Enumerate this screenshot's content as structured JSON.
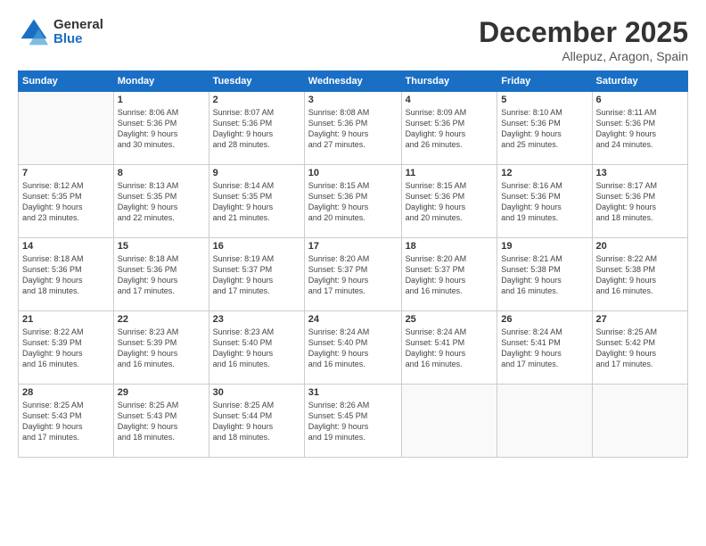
{
  "logo": {
    "line1": "General",
    "line2": "Blue"
  },
  "header": {
    "month": "December 2025",
    "location": "Allepuz, Aragon, Spain"
  },
  "weekdays": [
    "Sunday",
    "Monday",
    "Tuesday",
    "Wednesday",
    "Thursday",
    "Friday",
    "Saturday"
  ],
  "weeks": [
    [
      {
        "day": "",
        "info": ""
      },
      {
        "day": "1",
        "info": "Sunrise: 8:06 AM\nSunset: 5:36 PM\nDaylight: 9 hours\nand 30 minutes."
      },
      {
        "day": "2",
        "info": "Sunrise: 8:07 AM\nSunset: 5:36 PM\nDaylight: 9 hours\nand 28 minutes."
      },
      {
        "day": "3",
        "info": "Sunrise: 8:08 AM\nSunset: 5:36 PM\nDaylight: 9 hours\nand 27 minutes."
      },
      {
        "day": "4",
        "info": "Sunrise: 8:09 AM\nSunset: 5:36 PM\nDaylight: 9 hours\nand 26 minutes."
      },
      {
        "day": "5",
        "info": "Sunrise: 8:10 AM\nSunset: 5:36 PM\nDaylight: 9 hours\nand 25 minutes."
      },
      {
        "day": "6",
        "info": "Sunrise: 8:11 AM\nSunset: 5:36 PM\nDaylight: 9 hours\nand 24 minutes."
      }
    ],
    [
      {
        "day": "7",
        "info": "Sunrise: 8:12 AM\nSunset: 5:35 PM\nDaylight: 9 hours\nand 23 minutes."
      },
      {
        "day": "8",
        "info": "Sunrise: 8:13 AM\nSunset: 5:35 PM\nDaylight: 9 hours\nand 22 minutes."
      },
      {
        "day": "9",
        "info": "Sunrise: 8:14 AM\nSunset: 5:35 PM\nDaylight: 9 hours\nand 21 minutes."
      },
      {
        "day": "10",
        "info": "Sunrise: 8:15 AM\nSunset: 5:36 PM\nDaylight: 9 hours\nand 20 minutes."
      },
      {
        "day": "11",
        "info": "Sunrise: 8:15 AM\nSunset: 5:36 PM\nDaylight: 9 hours\nand 20 minutes."
      },
      {
        "day": "12",
        "info": "Sunrise: 8:16 AM\nSunset: 5:36 PM\nDaylight: 9 hours\nand 19 minutes."
      },
      {
        "day": "13",
        "info": "Sunrise: 8:17 AM\nSunset: 5:36 PM\nDaylight: 9 hours\nand 18 minutes."
      }
    ],
    [
      {
        "day": "14",
        "info": "Sunrise: 8:18 AM\nSunset: 5:36 PM\nDaylight: 9 hours\nand 18 minutes."
      },
      {
        "day": "15",
        "info": "Sunrise: 8:18 AM\nSunset: 5:36 PM\nDaylight: 9 hours\nand 17 minutes."
      },
      {
        "day": "16",
        "info": "Sunrise: 8:19 AM\nSunset: 5:37 PM\nDaylight: 9 hours\nand 17 minutes."
      },
      {
        "day": "17",
        "info": "Sunrise: 8:20 AM\nSunset: 5:37 PM\nDaylight: 9 hours\nand 17 minutes."
      },
      {
        "day": "18",
        "info": "Sunrise: 8:20 AM\nSunset: 5:37 PM\nDaylight: 9 hours\nand 16 minutes."
      },
      {
        "day": "19",
        "info": "Sunrise: 8:21 AM\nSunset: 5:38 PM\nDaylight: 9 hours\nand 16 minutes."
      },
      {
        "day": "20",
        "info": "Sunrise: 8:22 AM\nSunset: 5:38 PM\nDaylight: 9 hours\nand 16 minutes."
      }
    ],
    [
      {
        "day": "21",
        "info": "Sunrise: 8:22 AM\nSunset: 5:39 PM\nDaylight: 9 hours\nand 16 minutes."
      },
      {
        "day": "22",
        "info": "Sunrise: 8:23 AM\nSunset: 5:39 PM\nDaylight: 9 hours\nand 16 minutes."
      },
      {
        "day": "23",
        "info": "Sunrise: 8:23 AM\nSunset: 5:40 PM\nDaylight: 9 hours\nand 16 minutes."
      },
      {
        "day": "24",
        "info": "Sunrise: 8:24 AM\nSunset: 5:40 PM\nDaylight: 9 hours\nand 16 minutes."
      },
      {
        "day": "25",
        "info": "Sunrise: 8:24 AM\nSunset: 5:41 PM\nDaylight: 9 hours\nand 16 minutes."
      },
      {
        "day": "26",
        "info": "Sunrise: 8:24 AM\nSunset: 5:41 PM\nDaylight: 9 hours\nand 17 minutes."
      },
      {
        "day": "27",
        "info": "Sunrise: 8:25 AM\nSunset: 5:42 PM\nDaylight: 9 hours\nand 17 minutes."
      }
    ],
    [
      {
        "day": "28",
        "info": "Sunrise: 8:25 AM\nSunset: 5:43 PM\nDaylight: 9 hours\nand 17 minutes."
      },
      {
        "day": "29",
        "info": "Sunrise: 8:25 AM\nSunset: 5:43 PM\nDaylight: 9 hours\nand 18 minutes."
      },
      {
        "day": "30",
        "info": "Sunrise: 8:25 AM\nSunset: 5:44 PM\nDaylight: 9 hours\nand 18 minutes."
      },
      {
        "day": "31",
        "info": "Sunrise: 8:26 AM\nSunset: 5:45 PM\nDaylight: 9 hours\nand 19 minutes."
      },
      {
        "day": "",
        "info": ""
      },
      {
        "day": "",
        "info": ""
      },
      {
        "day": "",
        "info": ""
      }
    ]
  ]
}
